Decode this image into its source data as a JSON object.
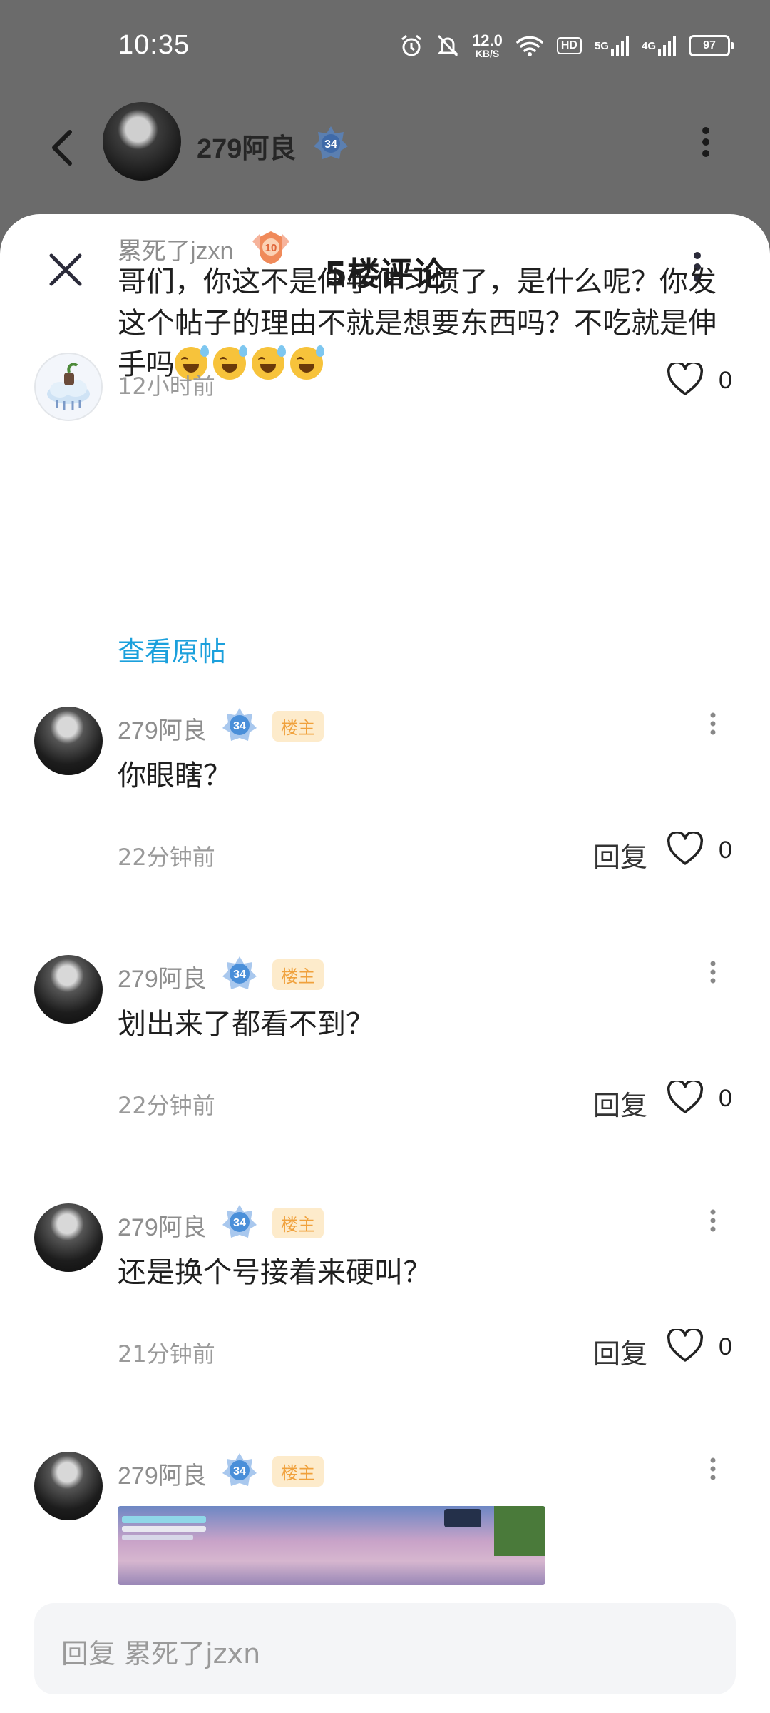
{
  "status_bar": {
    "time": "10:35",
    "speed_value": "12.0",
    "speed_unit": "KB/S",
    "hd_label": "HD",
    "net1": "5G",
    "net2": "4G",
    "battery": "97"
  },
  "header": {
    "username": "279阿良",
    "level": "34"
  },
  "sheet": {
    "title": "5楼评论"
  },
  "main_comment": {
    "username": "累死了jzxn",
    "level": "10",
    "text": "哥们，你这不是伸手伸习惯了，是什么呢？你发这个帖子的理由不就是想要东西吗？不吃就是伸手吗",
    "emoji_count": 4,
    "time": "12小时前",
    "likes": "0",
    "view_original": "查看原帖"
  },
  "replies": [
    {
      "username": "279阿良",
      "level": "34",
      "badge": "楼主",
      "text": "你眼瞎？",
      "time": "22分钟前",
      "reply_label": "回复",
      "likes": "0"
    },
    {
      "username": "279阿良",
      "level": "34",
      "badge": "楼主",
      "text": "划出来了都看不到？",
      "time": "22分钟前",
      "reply_label": "回复",
      "likes": "0"
    },
    {
      "username": "279阿良",
      "level": "34",
      "badge": "楼主",
      "text": "还是换个号接着来硬叫？",
      "time": "21分钟前",
      "reply_label": "回复",
      "likes": "0"
    },
    {
      "username": "279阿良",
      "level": "34",
      "badge": "楼主"
    }
  ],
  "reply_input": {
    "placeholder": "回复 累死了jzxn"
  },
  "colors": {
    "link": "#1ba0dc",
    "host_badge_bg": "#fdebcb",
    "host_badge_text": "#f0a13c",
    "level_blue": "#4a8fd9",
    "level_orange": "#f08a5a"
  }
}
